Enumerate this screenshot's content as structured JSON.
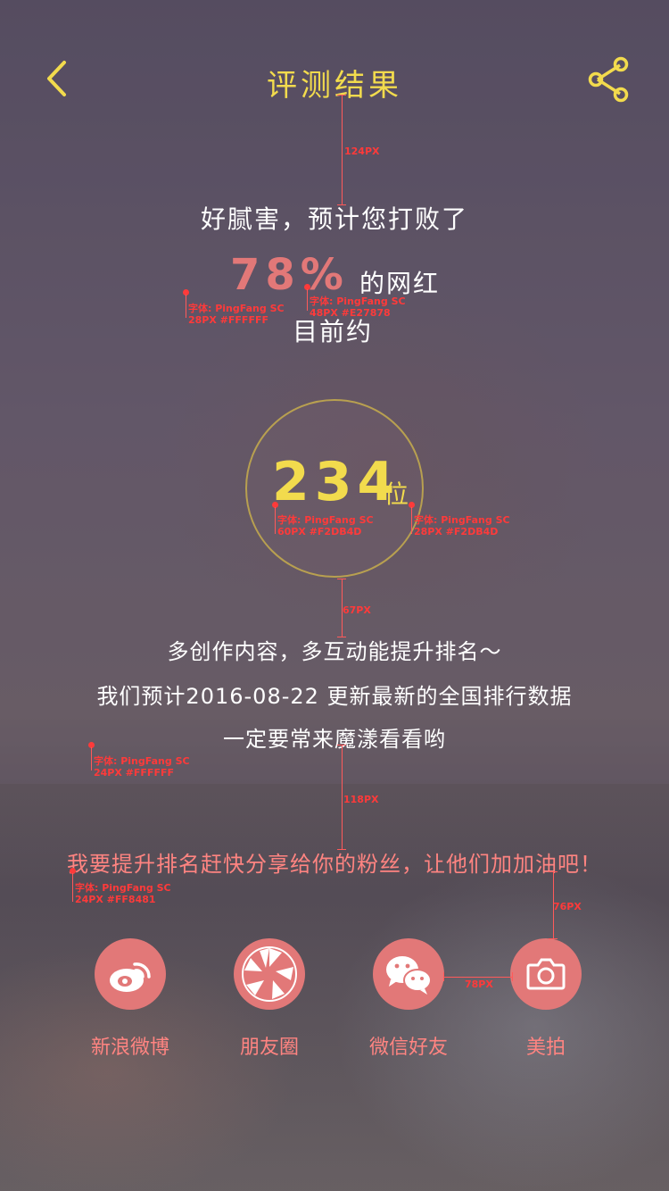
{
  "header": {
    "title": "评测结果",
    "back_icon": "back-chevron-icon",
    "share_icon": "share-icon"
  },
  "result": {
    "line1": "好腻害，预计您打败了",
    "percent": "78%",
    "percent_suffix": "的网红",
    "line3": "目前约",
    "rank_number": "234",
    "rank_unit": "位"
  },
  "tips": [
    "多创作内容，多互动能提升排名～",
    "我们预计2016-08-22  更新最新的全国排行数据",
    "一定要常来魔漾看看哟"
  ],
  "share": {
    "cta": "我要提升排名赶快分享给你的粉丝，让他们加加油吧！",
    "items": [
      {
        "label": "新浪微博",
        "icon": "weibo-icon"
      },
      {
        "label": "朋友圈",
        "icon": "moments-icon"
      },
      {
        "label": "微信好友",
        "icon": "wechat-icon"
      },
      {
        "label": "美拍",
        "icon": "camera-icon"
      }
    ]
  },
  "annotations": {
    "spacing_124": "124PX",
    "font_28_white": [
      "字体: PingFang SC",
      "28PX #FFFFFF"
    ],
    "font_48_red": [
      "字体: PingFang SC",
      "48PX #E27878"
    ],
    "font_60_yellow": [
      "字体: PingFang SC",
      "60PX #F2DB4D"
    ],
    "font_28_yellow": [
      "字体: PingFang SC",
      "28PX #F2DB4D"
    ],
    "spacing_67": "67PX",
    "font_24_white": [
      "字体: PingFang SC",
      "24PX #FFFFFF"
    ],
    "spacing_118": "118PX",
    "font_24_pink": [
      "字体: PingFang SC",
      "24PX #FF8481"
    ],
    "spacing_76": "76PX",
    "spacing_78": "78PX"
  },
  "colors": {
    "title": "#F2DB4D",
    "percent": "#E27878",
    "rank": "#F2DB4D",
    "share_text": "#FF8481",
    "icon_bg": "#E27878"
  }
}
